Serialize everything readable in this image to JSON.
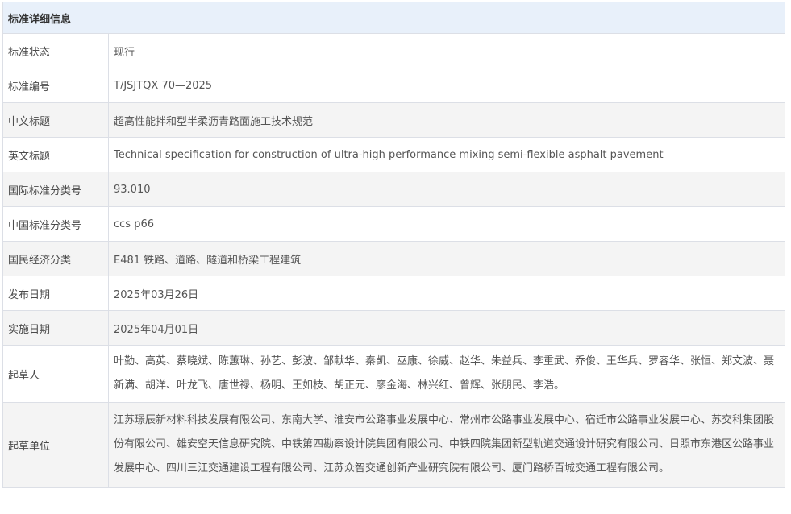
{
  "header": {
    "title": "标准详细信息"
  },
  "rows": [
    {
      "label": "标准状态",
      "value": "现行"
    },
    {
      "label": "标准编号",
      "value": "T/JSJTQX 70—2025"
    },
    {
      "label": "中文标题",
      "value": "超高性能拌和型半柔沥青路面施工技术规范"
    },
    {
      "label": "英文标题",
      "value": "Technical specification for construction of ultra-high performance mixing semi-flexible asphalt pavement"
    },
    {
      "label": "国际标准分类号",
      "value": "93.010"
    },
    {
      "label": "中国标准分类号",
      "value": "ccs p66"
    },
    {
      "label": "国民经济分类",
      "value": "E481 铁路、道路、隧道和桥梁工程建筑"
    },
    {
      "label": "发布日期",
      "value": "2025年03月26日"
    },
    {
      "label": "实施日期",
      "value": "2025年04月01日"
    },
    {
      "label": "起草人",
      "value": "叶勤、高英、蔡晓斌、陈蕙琳、孙艺、彭波、邹献华、秦凯、巫康、徐威、赵华、朱益兵、李重武、乔俊、王华兵、罗容华、张恒、郑文波、聂新满、胡洋、叶龙飞、唐世禄、杨明、王如枝、胡正元、廖金海、林兴红、曾辉、张朋民、李浩。"
    },
    {
      "label": "起草单位",
      "value": "江苏璟辰新材料科技发展有限公司、东南大学、淮安市公路事业发展中心、常州市公路事业发展中心、宿迁市公路事业发展中心、苏交科集团股份有限公司、雄安空天信息研究院、中铁第四勘察设计院集团有限公司、中铁四院集团新型轨道交通设计研究有限公司、日照市东港区公路事业发展中心、四川三江交通建设工程有限公司、江苏众智交通创新产业研究院有限公司、厦门路桥百城交通工程有限公司。"
    }
  ]
}
